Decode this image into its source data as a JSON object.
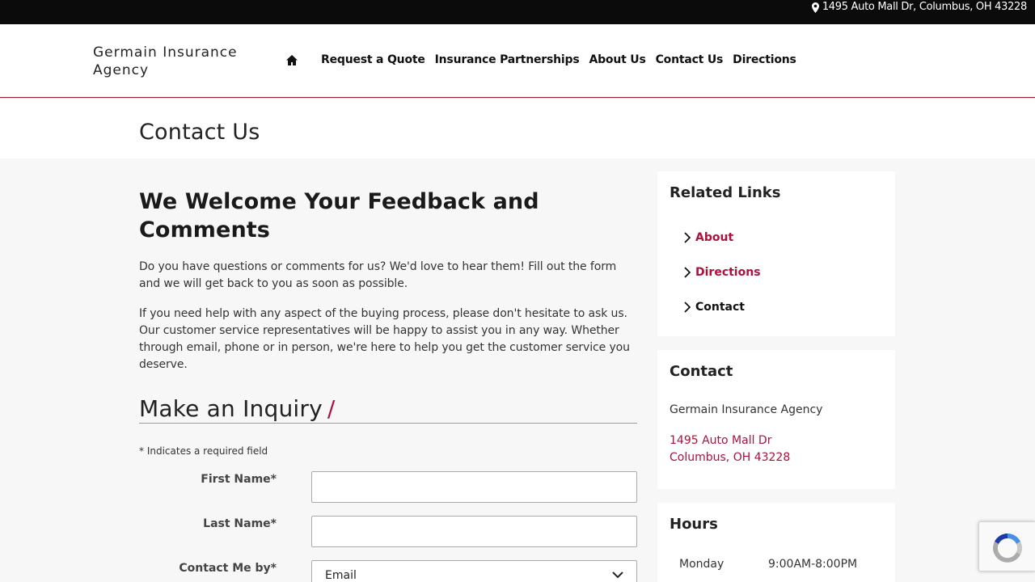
{
  "topbar": {
    "address": "1495 Auto Mall Dr, Columbus, OH 43228",
    "icon": "map-pin-icon"
  },
  "header": {
    "brand_line1": "Germain Insurance",
    "brand_line2": "Agency",
    "home_icon": "home-icon",
    "nav": [
      {
        "label": "Request a Quote"
      },
      {
        "label": "Insurance Partnerships"
      },
      {
        "label": "About Us"
      },
      {
        "label": "Contact Us"
      },
      {
        "label": "Directions"
      }
    ]
  },
  "page": {
    "title": "Contact Us"
  },
  "main": {
    "heading": "We Welcome Your Feedback and Comments",
    "para1": "Do you have questions or comments for us? We'd love to hear them! Fill out the form and we will get back to you as soon as possible.",
    "para2": "If you need help with any aspect of the buying process, please don't hesitate to ask us. Our customer service representatives will be happy to assist you in any way. Whether through email, phone or in person, we're here to help you get the customer service you deserve."
  },
  "form": {
    "title": "Make an Inquiry",
    "title_accent": "/",
    "required_note": "* Indicates a required field",
    "first_name_label": "First Name*",
    "first_name_value": "",
    "last_name_label": "Last Name*",
    "last_name_value": "",
    "contact_by_label": "Contact Me by*",
    "contact_by_value": "Email"
  },
  "sidebar": {
    "related_title": "Related Links",
    "related_links": [
      {
        "label": "About",
        "active": true
      },
      {
        "label": "Directions",
        "active": true
      },
      {
        "label": "Contact",
        "active": false
      }
    ],
    "contact_title": "Contact",
    "contact_name": "Germain Insurance Agency",
    "contact_addr1": "1495 Auto Mall Dr",
    "contact_addr2": "Columbus, OH 43228",
    "hours_title": "Hours",
    "hours": [
      {
        "day": "Monday",
        "time": "9:00AM-8:00PM"
      }
    ]
  },
  "colors": {
    "accent": "#b0103a",
    "topbar": "#0b0b0b"
  }
}
